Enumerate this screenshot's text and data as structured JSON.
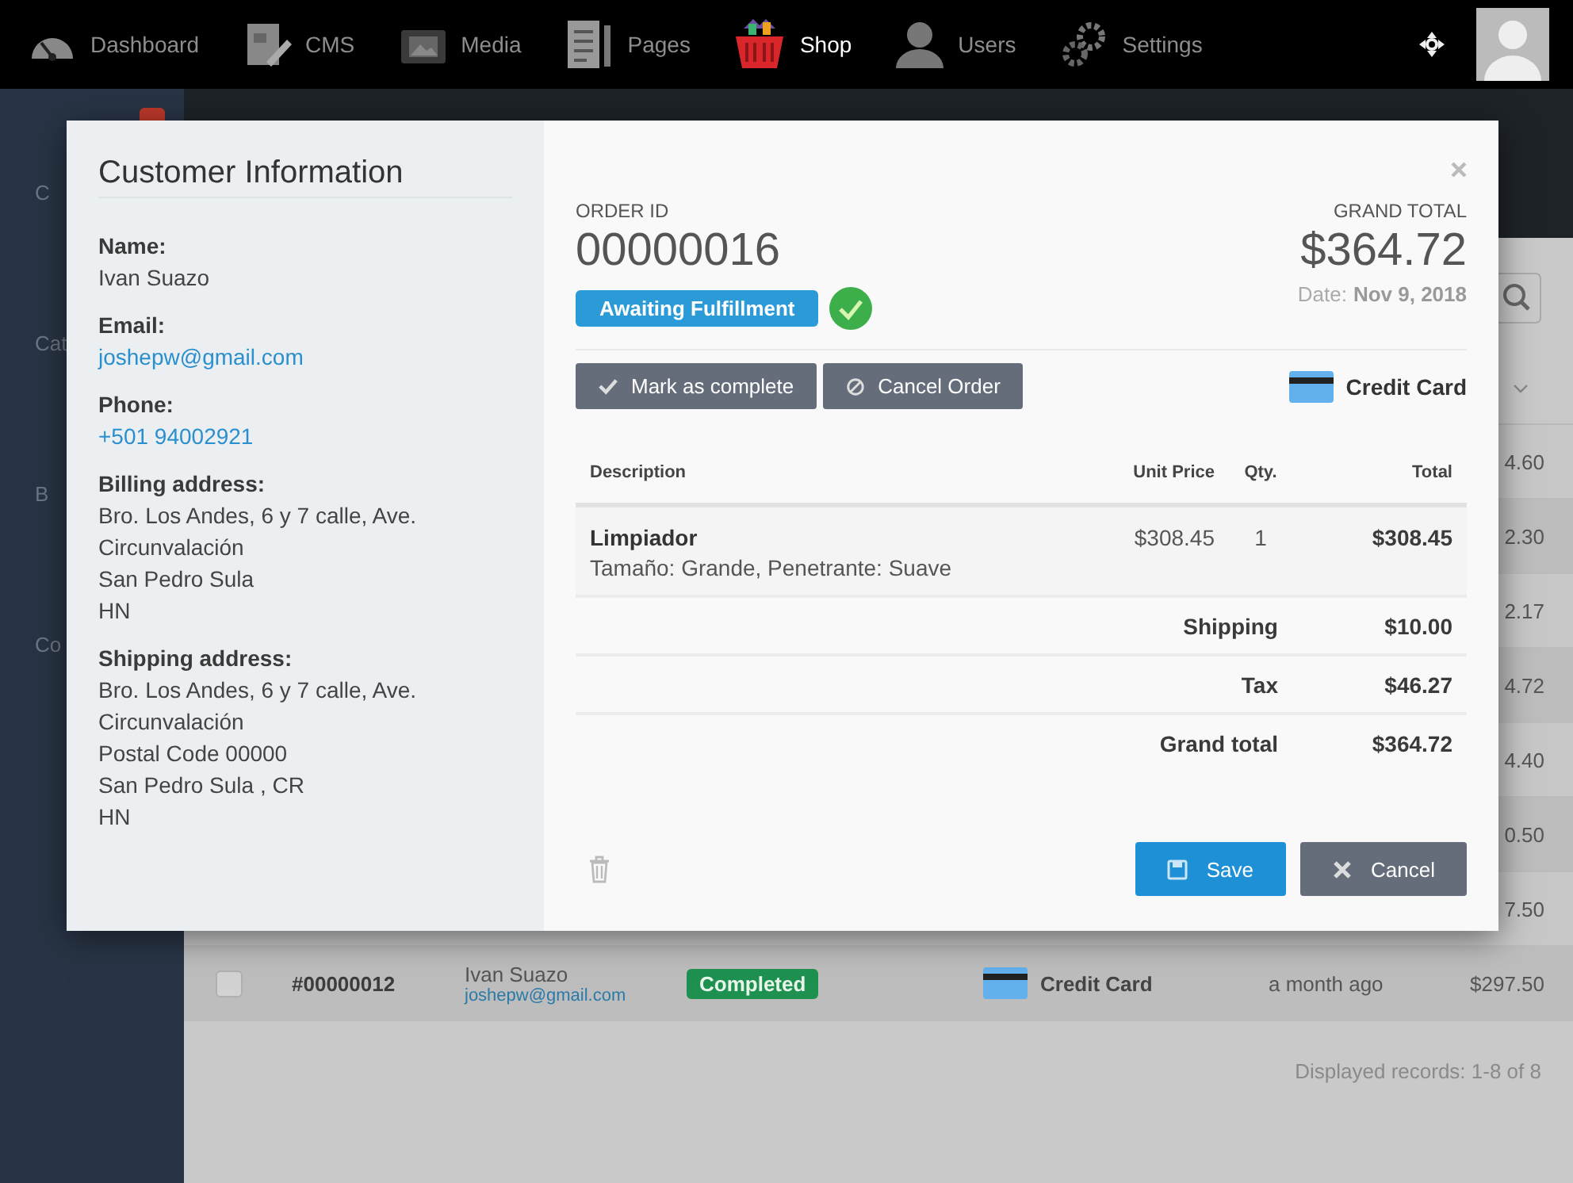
{
  "nav": {
    "items": [
      {
        "label": "Dashboard",
        "kind": "gauge",
        "selected": false
      },
      {
        "label": "CMS",
        "kind": "doc",
        "selected": false
      },
      {
        "label": "Media",
        "kind": "photo",
        "selected": false
      },
      {
        "label": "Pages",
        "kind": "pages",
        "selected": false
      },
      {
        "label": "Shop",
        "kind": "basket",
        "selected": true
      },
      {
        "label": "Users",
        "kind": "user",
        "selected": false
      },
      {
        "label": "Settings",
        "kind": "gears",
        "selected": false
      }
    ]
  },
  "sidebar": {
    "items": [
      "C",
      "Cat",
      "B",
      "Co"
    ]
  },
  "orders": {
    "rows": [
      {
        "total": "4.60"
      },
      {
        "total": "2.30"
      },
      {
        "total": "2.17"
      },
      {
        "total": "4.72"
      },
      {
        "total": "4.40"
      },
      {
        "total": "0.50"
      },
      {
        "total": "7.50"
      },
      {
        "checked": false,
        "id": "#00000012",
        "customer": "Ivan Suazo",
        "email": "joshepw@gmail.com",
        "status": {
          "label": "Completed",
          "kind": "completed"
        },
        "payment": "Credit Card",
        "time": "a month ago",
        "total": "$297.50"
      }
    ],
    "footer": "Displayed records: 1-8 of 8"
  },
  "modal": {
    "customer": {
      "title": "Customer Information",
      "fields": [
        {
          "label": "Name:",
          "kind": "text",
          "lines": [
            "Ivan Suazo"
          ]
        },
        {
          "label": "Email:",
          "kind": "link",
          "lines": [
            "joshepw@gmail.com"
          ]
        },
        {
          "label": "Phone:",
          "kind": "link",
          "lines": [
            "+501 94002921"
          ]
        },
        {
          "label": "Billing address:",
          "kind": "text",
          "lines": [
            "Bro. Los Andes, 6 y 7 calle, Ave.",
            "Circunvalación",
            "San Pedro Sula",
            "HN"
          ]
        },
        {
          "label": "Shipping address:",
          "kind": "text",
          "lines": [
            "Bro. Los Andes, 6 y 7 calle, Ave.",
            "Circunvalación",
            "Postal Code 00000",
            "San Pedro Sula , CR",
            "HN"
          ]
        }
      ]
    },
    "order": {
      "id_label": "ORDER ID",
      "id": "00000016",
      "status": {
        "label": "Awaiting Fulfillment",
        "kind": "awaiting"
      },
      "total_label": "GRAND TOTAL",
      "total": "$364.72",
      "date_label": "Date:",
      "date": "Nov 9, 2018",
      "actions": [
        {
          "label": "Mark as complete",
          "kind": "check"
        },
        {
          "label": "Cancel Order",
          "kind": "ban"
        }
      ],
      "payment": "Credit Card",
      "columns": [
        "Description",
        "Unit Price",
        "Qty.",
        "Total"
      ],
      "items": [
        {
          "name": "Limpiador",
          "options": "Tamaño: Grande, Penetrante: Suave",
          "unit_price": "$308.45",
          "qty": "1",
          "total": "$308.45"
        }
      ],
      "summary": [
        {
          "label": "Shipping",
          "value": "$10.00"
        },
        {
          "label": "Tax",
          "value": "$46.27"
        },
        {
          "label": "Grand total",
          "value": "$364.72"
        }
      ],
      "buttons": [
        {
          "label": "Save",
          "kind": "primary"
        },
        {
          "label": "Cancel",
          "kind": "secondary"
        }
      ]
    }
  }
}
